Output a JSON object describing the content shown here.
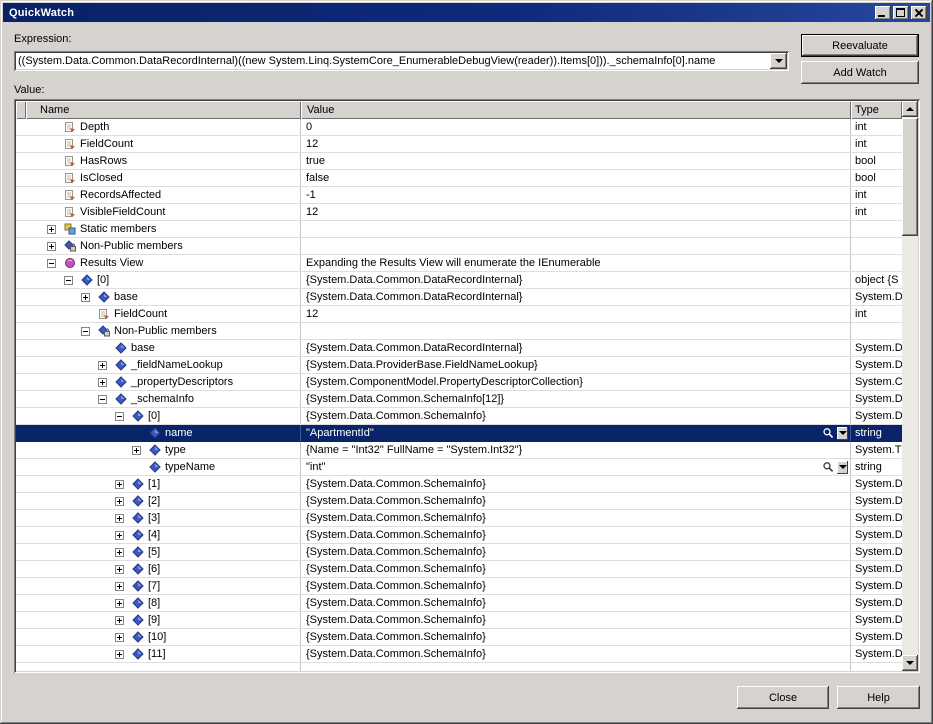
{
  "window": {
    "title": "QuickWatch"
  },
  "expression": {
    "label": "Expression:",
    "value": "((System.Data.Common.DataRecordInternal)((new System.Linq.SystemCore_EnumerableDebugView(reader)).Items[0]))._schemaInfo[0].name"
  },
  "actions": {
    "reevaluate": "Reevaluate",
    "add_watch": "Add Watch"
  },
  "value_label": "Value:",
  "footer": {
    "close": "Close",
    "help": "Help"
  },
  "colors": {
    "selection": "#0a246a",
    "titlebar": "#0a2167",
    "dialog_bg": "#d6d3ce",
    "field_icon_blue": "#3b5bc4",
    "results_view_magenta": "#c050c0"
  },
  "grid": {
    "columns": [
      "Name",
      "Value",
      "Type"
    ],
    "rows": [
      {
        "level": 0,
        "exp": "",
        "icon": "property",
        "name": "Depth",
        "value": "0",
        "type": "int"
      },
      {
        "level": 0,
        "exp": "",
        "icon": "property",
        "name": "FieldCount",
        "value": "12",
        "type": "int"
      },
      {
        "level": 0,
        "exp": "",
        "icon": "property",
        "name": "HasRows",
        "value": "true",
        "type": "bool"
      },
      {
        "level": 0,
        "exp": "",
        "icon": "property",
        "name": "IsClosed",
        "value": "false",
        "type": "bool"
      },
      {
        "level": 0,
        "exp": "",
        "icon": "property",
        "name": "RecordsAffected",
        "value": "-1",
        "type": "int"
      },
      {
        "level": 0,
        "exp": "",
        "icon": "property",
        "name": "VisibleFieldCount",
        "value": "12",
        "type": "int"
      },
      {
        "level": 0,
        "exp": "+",
        "icon": "static-members",
        "name": "Static members",
        "value": "",
        "type": ""
      },
      {
        "level": 0,
        "exp": "+",
        "icon": "non-public",
        "name": "Non-Public members",
        "value": "",
        "type": ""
      },
      {
        "level": 0,
        "exp": "-",
        "icon": "results-view",
        "name": "Results View",
        "value": "Expanding the Results View will enumerate the IEnumerable",
        "type": ""
      },
      {
        "level": 1,
        "exp": "-",
        "icon": "field",
        "name": "[0]",
        "value": "{System.Data.Common.DataRecordInternal}",
        "type": "object {S"
      },
      {
        "level": 2,
        "exp": "+",
        "icon": "field",
        "name": "base",
        "value": "{System.Data.Common.DataRecordInternal}",
        "type": "System.D"
      },
      {
        "level": 2,
        "exp": "",
        "icon": "property",
        "name": "FieldCount",
        "value": "12",
        "type": "int"
      },
      {
        "level": 2,
        "exp": "-",
        "icon": "non-public",
        "name": "Non-Public members",
        "value": "",
        "type": ""
      },
      {
        "level": 3,
        "exp": "",
        "icon": "field",
        "name": "base",
        "value": "{System.Data.Common.DataRecordInternal}",
        "type": "System.D"
      },
      {
        "level": 3,
        "exp": "+",
        "icon": "field",
        "name": "_fieldNameLookup",
        "value": "{System.Data.ProviderBase.FieldNameLookup}",
        "type": "System.D"
      },
      {
        "level": 3,
        "exp": "+",
        "icon": "field",
        "name": "_propertyDescriptors",
        "value": "{System.ComponentModel.PropertyDescriptorCollection}",
        "type": "System.C"
      },
      {
        "level": 3,
        "exp": "-",
        "icon": "field",
        "name": "_schemaInfo",
        "value": "{System.Data.Common.SchemaInfo[12]}",
        "type": "System.D"
      },
      {
        "level": 4,
        "exp": "-",
        "icon": "field",
        "name": "[0]",
        "value": "{System.Data.Common.SchemaInfo}",
        "type": "System.D"
      },
      {
        "level": 5,
        "exp": "",
        "icon": "field",
        "name": "name",
        "value": "\"ApartmentId\"",
        "type": "string",
        "sel": true,
        "mag": true
      },
      {
        "level": 5,
        "exp": "+",
        "icon": "field",
        "name": "type",
        "value": "{Name = \"Int32\" FullName = \"System.Int32\"}",
        "type": "System.T"
      },
      {
        "level": 5,
        "exp": "",
        "icon": "field",
        "name": "typeName",
        "value": "\"int\"",
        "type": "string",
        "mag": true
      },
      {
        "level": 4,
        "exp": "+",
        "icon": "field",
        "name": "[1]",
        "value": "{System.Data.Common.SchemaInfo}",
        "type": "System.D"
      },
      {
        "level": 4,
        "exp": "+",
        "icon": "field",
        "name": "[2]",
        "value": "{System.Data.Common.SchemaInfo}",
        "type": "System.D"
      },
      {
        "level": 4,
        "exp": "+",
        "icon": "field",
        "name": "[3]",
        "value": "{System.Data.Common.SchemaInfo}",
        "type": "System.D"
      },
      {
        "level": 4,
        "exp": "+",
        "icon": "field",
        "name": "[4]",
        "value": "{System.Data.Common.SchemaInfo}",
        "type": "System.D"
      },
      {
        "level": 4,
        "exp": "+",
        "icon": "field",
        "name": "[5]",
        "value": "{System.Data.Common.SchemaInfo}",
        "type": "System.D"
      },
      {
        "level": 4,
        "exp": "+",
        "icon": "field",
        "name": "[6]",
        "value": "{System.Data.Common.SchemaInfo}",
        "type": "System.D"
      },
      {
        "level": 4,
        "exp": "+",
        "icon": "field",
        "name": "[7]",
        "value": "{System.Data.Common.SchemaInfo}",
        "type": "System.D"
      },
      {
        "level": 4,
        "exp": "+",
        "icon": "field",
        "name": "[8]",
        "value": "{System.Data.Common.SchemaInfo}",
        "type": "System.D"
      },
      {
        "level": 4,
        "exp": "+",
        "icon": "field",
        "name": "[9]",
        "value": "{System.Data.Common.SchemaInfo}",
        "type": "System.D"
      },
      {
        "level": 4,
        "exp": "+",
        "icon": "field",
        "name": "[10]",
        "value": "{System.Data.Common.SchemaInfo}",
        "type": "System.D"
      },
      {
        "level": 4,
        "exp": "+",
        "icon": "field",
        "name": "[11]",
        "value": "{System.Data.Common.SchemaInfo}",
        "type": "System.D"
      }
    ]
  }
}
